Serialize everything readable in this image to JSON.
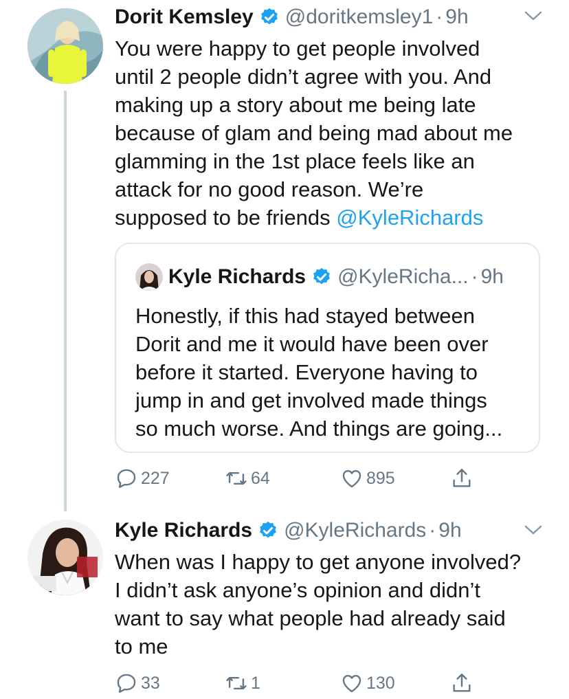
{
  "tweets": [
    {
      "author_name": "Dorit Kemsley",
      "handle": "@doritkemsley1",
      "separator": "·",
      "time": "9h",
      "text_lines": [
        "You were happy to get people involved",
        "until 2 people didn’t agree with you. And",
        "making up a story about me being late",
        "because of glam and being mad about me",
        "glamming in the 1st place feels like an",
        "attack for no good reason. We’re",
        "supposed to be friends "
      ],
      "mention": "@KyleRichards",
      "quoted": {
        "author_name": "Kyle Richards",
        "handle": "@KyleRicha...",
        "separator": "·",
        "time": "9h",
        "text": "Honestly, if this had stayed between\nDorit and me it would have been over\nbefore it started. Everyone having to\njump in and get involved made things\nso much worse. And things are going..."
      },
      "replies": "227",
      "retweets": "64",
      "likes": "895"
    },
    {
      "author_name": "Kyle Richards",
      "handle": "@KyleRichards",
      "separator": "·",
      "time": "9h",
      "text": "When was I happy to get anyone involved?\nI didn’t ask anyone’s opinion and didn’t\nwant to say what people had already said\nto me",
      "replies": "33",
      "retweets": "1",
      "likes": "130"
    }
  ],
  "icons": {
    "verified": "verified-badge-icon",
    "more": "chevron-down-icon",
    "reply": "reply-icon",
    "retweet": "retweet-icon",
    "like": "heart-icon",
    "share": "share-icon"
  },
  "colors": {
    "text": "#14171a",
    "secondary": "#657786",
    "accent": "#1da1f2",
    "border": "#e1e8ed"
  }
}
